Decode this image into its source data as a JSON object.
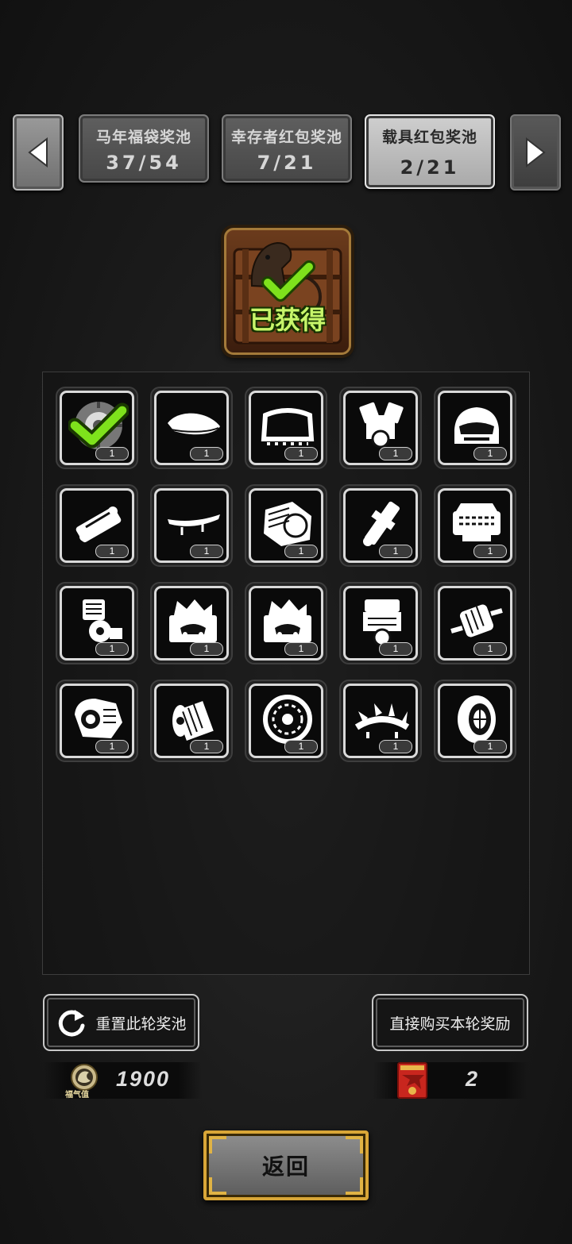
{
  "tabs": [
    {
      "title": "马年福袋奖池",
      "count": "37/54",
      "active": false
    },
    {
      "title": "幸存者红包奖池",
      "count": "7/21",
      "active": false
    },
    {
      "title": "载具红包奖池",
      "count": "2/21",
      "active": true
    }
  ],
  "chest": {
    "status": "已获得"
  },
  "items": [
    {
      "icon": "tire-icon",
      "qty": "1",
      "obtained": true
    },
    {
      "icon": "roof-box-icon",
      "qty": "1",
      "obtained": false
    },
    {
      "icon": "windshield-frame-icon",
      "qty": "1",
      "obtained": false
    },
    {
      "icon": "v-engine-icon",
      "qty": "1",
      "obtained": false
    },
    {
      "icon": "car-front-icon",
      "qty": "1",
      "obtained": false
    },
    {
      "icon": "fuel-pump-icon",
      "qty": "1",
      "obtained": false
    },
    {
      "icon": "spoiler-icon",
      "qty": "1",
      "obtained": false
    },
    {
      "icon": "engine-block-icon",
      "qty": "1",
      "obtained": false
    },
    {
      "icon": "shock-absorber-icon",
      "qty": "1",
      "obtained": false
    },
    {
      "icon": "v8-engine-icon",
      "qty": "1",
      "obtained": false
    },
    {
      "icon": "motorcycle-engine-icon",
      "qty": "1",
      "obtained": false
    },
    {
      "icon": "toolbox-icon",
      "qty": "1",
      "obtained": false
    },
    {
      "icon": "toolbox-icon",
      "qty": "1",
      "obtained": false
    },
    {
      "icon": "engine-assembly-icon",
      "qty": "1",
      "obtained": false
    },
    {
      "icon": "alternator-icon",
      "qty": "1",
      "obtained": false
    },
    {
      "icon": "turbo-engine-icon",
      "qty": "1",
      "obtained": false
    },
    {
      "icon": "electric-motor-icon",
      "qty": "1",
      "obtained": false
    },
    {
      "icon": "snow-chain-icon",
      "qty": "1",
      "obtained": false
    },
    {
      "icon": "spiked-bumper-icon",
      "qty": "1",
      "obtained": false
    },
    {
      "icon": "sport-tire-icon",
      "qty": "1",
      "obtained": false
    }
  ],
  "buttons": {
    "reset": "重置此轮奖池",
    "buy": "直接购买本轮奖励",
    "back": "返回"
  },
  "currency": {
    "fortune_label": "福气值",
    "fortune_value": "1900",
    "redpacket_value": "2"
  }
}
